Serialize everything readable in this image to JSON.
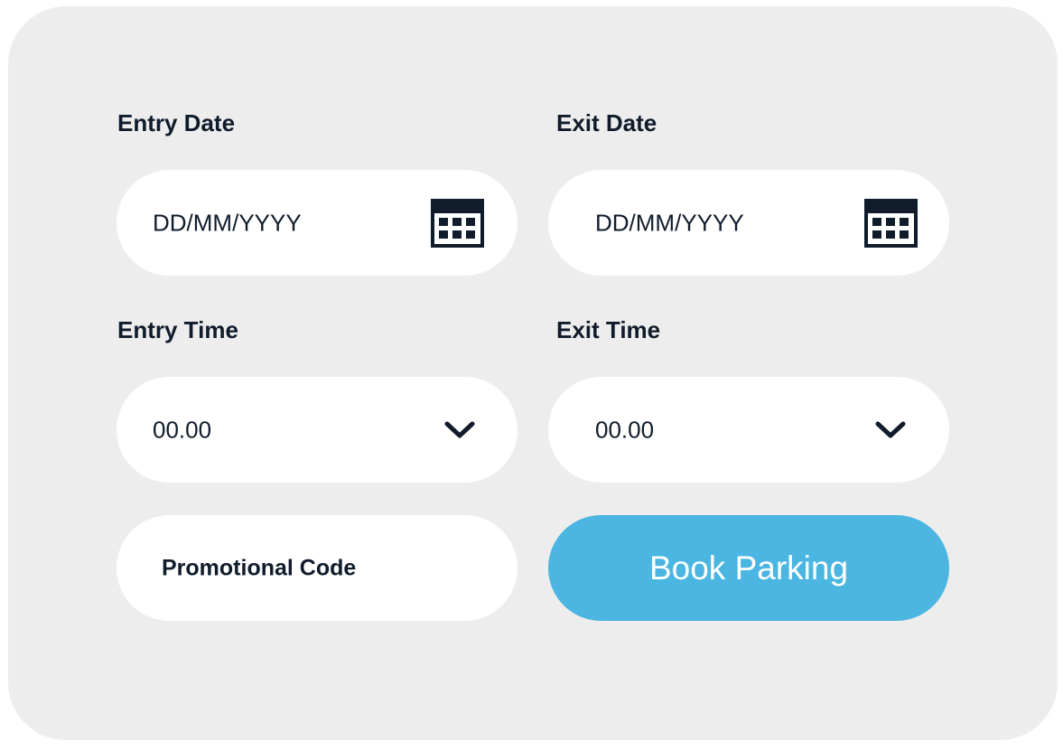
{
  "form": {
    "entry_date": {
      "label": "Entry Date",
      "placeholder": "DD/MM/YYYY",
      "icon": "calendar-icon"
    },
    "exit_date": {
      "label": "Exit Date",
      "placeholder": "DD/MM/YYYY",
      "icon": "calendar-icon"
    },
    "entry_time": {
      "label": "Entry Time",
      "value": "00.00",
      "icon": "chevron-down-icon"
    },
    "exit_time": {
      "label": "Exit Time",
      "value": "00.00",
      "icon": "chevron-down-icon"
    },
    "promo": {
      "placeholder": "Promotional Code"
    },
    "submit": {
      "label": "Book Parking"
    }
  },
  "colors": {
    "card_background": "#ededed",
    "field_background": "#ffffff",
    "text": "#101c2c",
    "button": "#4ab6e1",
    "button_text": "#ffffff"
  }
}
